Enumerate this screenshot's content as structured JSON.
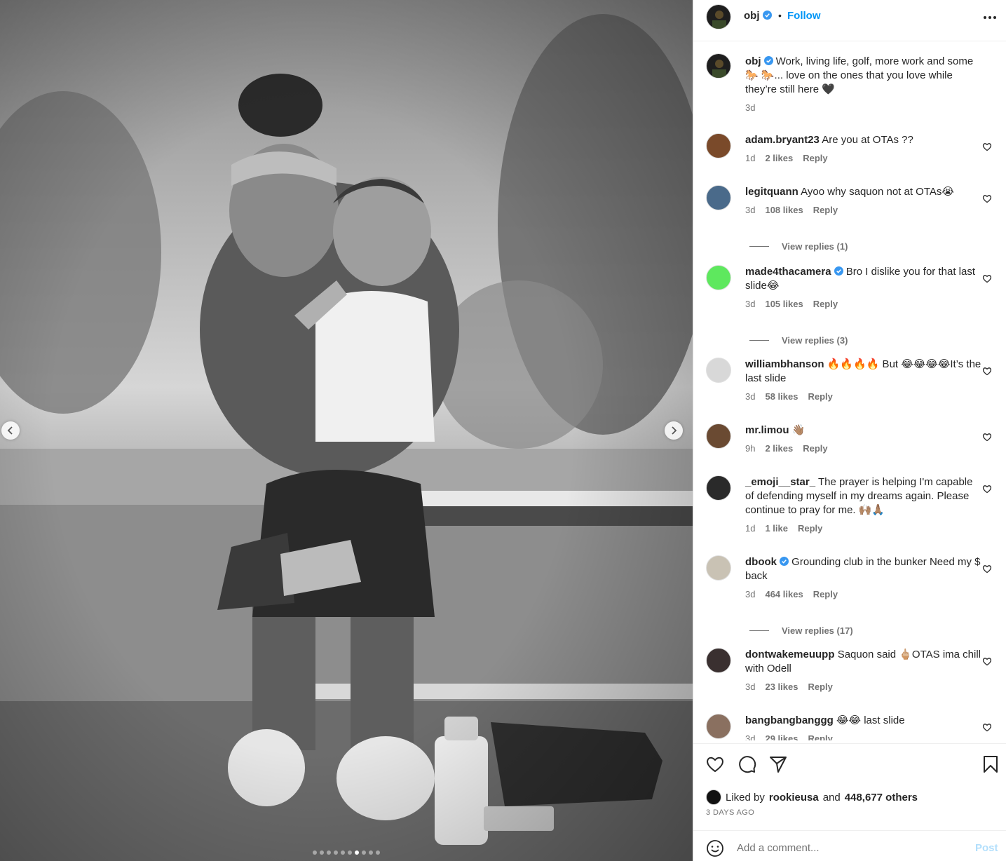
{
  "post": {
    "username": "obj",
    "separator": "•",
    "follow_label": "Follow",
    "more_icon": "more-horizontal-icon"
  },
  "caption": {
    "username": "obj",
    "text": "Work, living life, golf, more work and some 🐎 🐎... love on the ones that you love while they’re still here 🖤",
    "time": "3d"
  },
  "comments": [
    {
      "username": "adam.bryant23",
      "verified": false,
      "text": "Are you at OTAs ??",
      "time": "1d",
      "likes": "2 likes",
      "reply": "Reply",
      "avatar_color": "#7a4a2a"
    },
    {
      "username": "legitquann",
      "verified": false,
      "text": "Ayoo why saquon not at OTAs😭",
      "time": "3d",
      "likes": "108 likes",
      "reply": "Reply",
      "view_replies": "View replies (1)",
      "avatar_color": "#4a6a8a"
    },
    {
      "username": "made4thacamera",
      "verified": true,
      "text": "Bro I dislike you for that last slide😂",
      "time": "3d",
      "likes": "105 likes",
      "reply": "Reply",
      "view_replies": "View replies (3)",
      "avatar_color": "#5ee85e"
    },
    {
      "username": "williambhanson",
      "verified": false,
      "text": "🔥🔥🔥🔥 But 😂😂😂😂It’s the last slide",
      "time": "3d",
      "likes": "58 likes",
      "reply": "Reply",
      "avatar_color": "#d8d8d8"
    },
    {
      "username": "mr.limou",
      "verified": false,
      "text": "👋🏽",
      "time": "9h",
      "likes": "2 likes",
      "reply": "Reply",
      "avatar_color": "#6a4a32"
    },
    {
      "username": "_emoji__star_",
      "verified": false,
      "text": "The prayer is helping I'm capable of defending myself in my dreams again. Please continue to pray for me. 🙌🏽🙏🏽",
      "time": "1d",
      "likes": "1 like",
      "reply": "Reply",
      "avatar_color": "#2a2a2a"
    },
    {
      "username": "dbook",
      "verified": true,
      "text": "Grounding club in the bunker Need my $ back",
      "time": "3d",
      "likes": "464 likes",
      "reply": "Reply",
      "view_replies": "View replies (17)",
      "avatar_color": "#c9c2b4"
    },
    {
      "username": "dontwakemeuupp",
      "verified": false,
      "text": "Saquon said 🖕🏼OTAS ima chill with Odell",
      "time": "3d",
      "likes": "23 likes",
      "reply": "Reply",
      "avatar_color": "#3a3030"
    },
    {
      "username": "bangbangbanggg",
      "verified": false,
      "text": "😂😂 last slide",
      "time": "3d",
      "likes": "29 likes",
      "reply": "Reply",
      "avatar_color": "#8a7060"
    }
  ],
  "actions": {
    "icons": [
      "heart-icon",
      "comment-icon",
      "share-icon",
      "bookmark-icon"
    ],
    "liked_by_prefix": "Liked by",
    "liked_by_user": "rookieusa",
    "liked_by_and": "and",
    "liked_by_others": "448,677 others",
    "date": "3 DAYS AGO"
  },
  "add_comment": {
    "placeholder": "Add a comment...",
    "post_label": "Post"
  },
  "carousel": {
    "slide_count": 10,
    "active_index": 6
  },
  "colors": {
    "link_blue": "#0095f6",
    "muted": "#737373",
    "post_disabled": "#b2dffc",
    "verified": "#3897f0"
  }
}
